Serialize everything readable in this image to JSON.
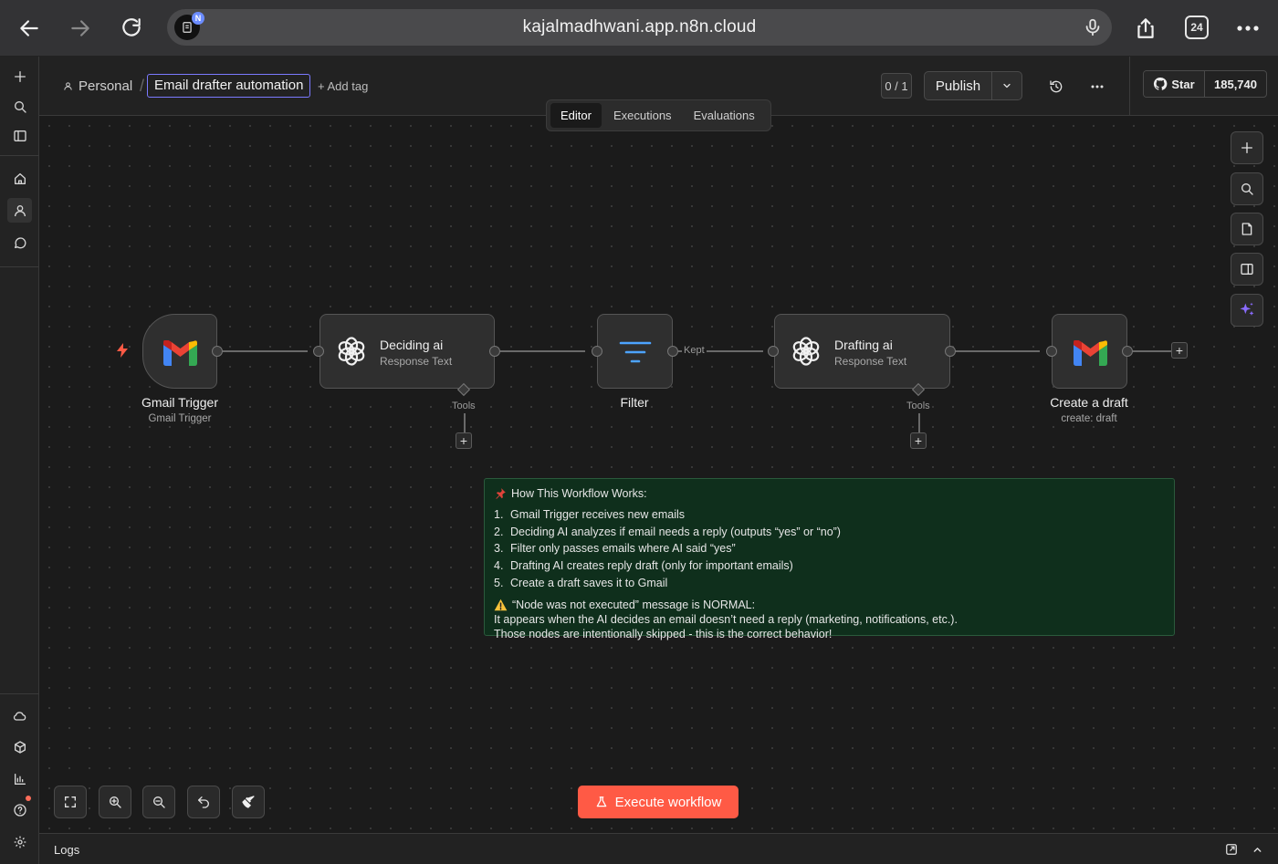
{
  "browser": {
    "url": "kajalmadhwani.app.n8n.cloud",
    "site_badge": "N",
    "tab_count": "24"
  },
  "header": {
    "breadcrumb_owner": "Personal",
    "workflow_name": "Email drafter automation",
    "add_tag": "+ Add tag",
    "version_counter": "0 / 1",
    "publish_label": "Publish",
    "github_star_label": "Star",
    "github_star_count": "185,740"
  },
  "mode_tabs": [
    {
      "label": "Editor",
      "active": true
    },
    {
      "label": "Executions",
      "active": false
    },
    {
      "label": "Evaluations",
      "active": false
    }
  ],
  "nodes": {
    "gmail_trigger": {
      "label": "Gmail Trigger",
      "sublabel": "Gmail Trigger",
      "icon": "gmail-icon"
    },
    "deciding_ai": {
      "title": "Deciding ai",
      "subtitle": "Response Text",
      "tools_label": "Tools",
      "icon": "openai-icon"
    },
    "filter": {
      "label": "Filter",
      "icon": "filter-icon",
      "output_label": "Kept"
    },
    "drafting_ai": {
      "title": "Drafting ai",
      "subtitle": "Response Text",
      "tools_label": "Tools",
      "icon": "openai-icon"
    },
    "create_draft": {
      "label": "Create a draft",
      "sublabel": "create: draft",
      "icon": "gmail-icon"
    }
  },
  "sticky_note": {
    "title": "How This Workflow Works:",
    "steps": [
      {
        "num": "1.",
        "text": "Gmail Trigger receives new emails"
      },
      {
        "num": "2.",
        "text": "Deciding AI analyzes if email needs a reply (outputs “yes” or “no”)"
      },
      {
        "num": "3.",
        "text": "Filter only passes emails where AI said “yes”"
      },
      {
        "num": "4.",
        "text": "Drafting AI creates reply draft (only for important emails)"
      },
      {
        "num": "5.",
        "text": "Create a draft saves it to Gmail"
      }
    ],
    "warning_title": "“Node was not executed” message is NORMAL:",
    "warning_line1": "It appears when the AI decides an email doesn’t need a reply (marketing, notifications, etc.).",
    "warning_line2": "Those nodes are intentionally skipped - this is the correct behavior!"
  },
  "execute_label": "Execute workflow",
  "logs_label": "Logs",
  "colors": {
    "accent": "#ff5a45",
    "note_bg": "#0f2f1c",
    "workflow_name_border": "#7b79ff",
    "canvas_bg": "#1b1b1b"
  }
}
